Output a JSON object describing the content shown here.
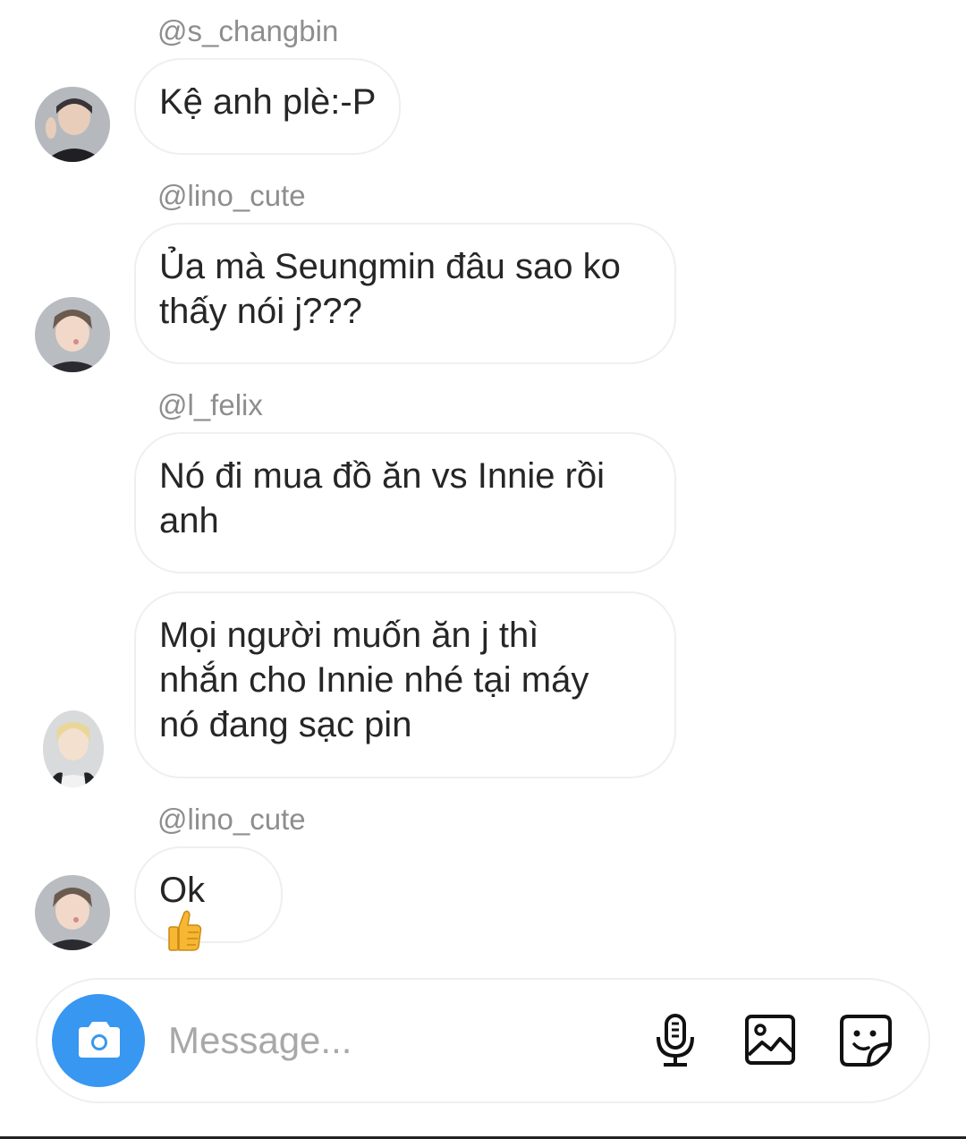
{
  "thread": {
    "messages": [
      {
        "username": "@s_changbin",
        "lines": [
          "Kệ anh plè:-P"
        ]
      },
      {
        "username": "@lino_cute",
        "lines": [
          "Ủa mà Seungmin đâu sao ko",
          "thấy nói j???"
        ]
      },
      {
        "username": "@l_felix",
        "lines": [
          "Nó đi mua đồ ăn vs Innie rồi",
          "anh"
        ]
      },
      {
        "username": "",
        "lines": [
          "Mọi người muốn ăn j thì",
          "nhắn cho Innie nhé tại máy",
          "nó đang sạc pin"
        ]
      },
      {
        "username": "@lino_cute",
        "text": "Ok",
        "emoji": "thumbs-up-icon"
      }
    ]
  },
  "composer": {
    "placeholder": "Message...",
    "value": "",
    "icons": [
      "camera-icon",
      "microphone-icon",
      "gallery-icon",
      "sticker-icon"
    ]
  },
  "colors": {
    "accent": "#3897f0",
    "username": "#8e8e8e",
    "bubble_border": "#efefef",
    "text": "#262626"
  }
}
